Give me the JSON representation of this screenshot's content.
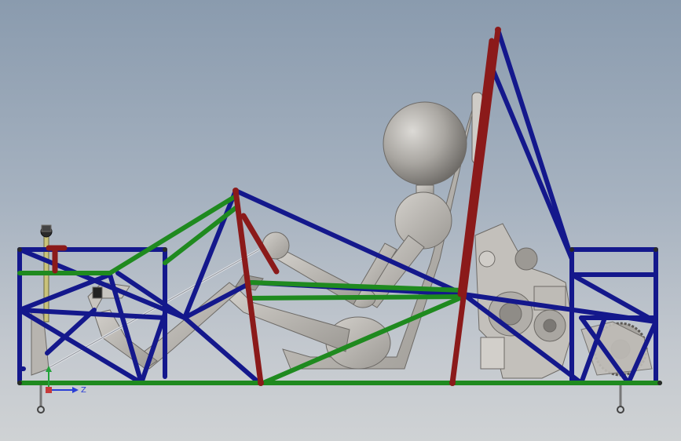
{
  "viewport": {
    "background_top": "#8a9bae",
    "background_bottom": "#cfd2d4"
  },
  "colors": {
    "main_hoop": "#8b1a1a",
    "side_members": "#1f8a1f",
    "bracing": "#14188c",
    "body_parts": "#b9b6b0",
    "axis_z": "#2b3fd6",
    "axis_y": "#23a23a"
  },
  "triad": {
    "z_label": "Z",
    "icon": "coordinate-triad-icon"
  }
}
